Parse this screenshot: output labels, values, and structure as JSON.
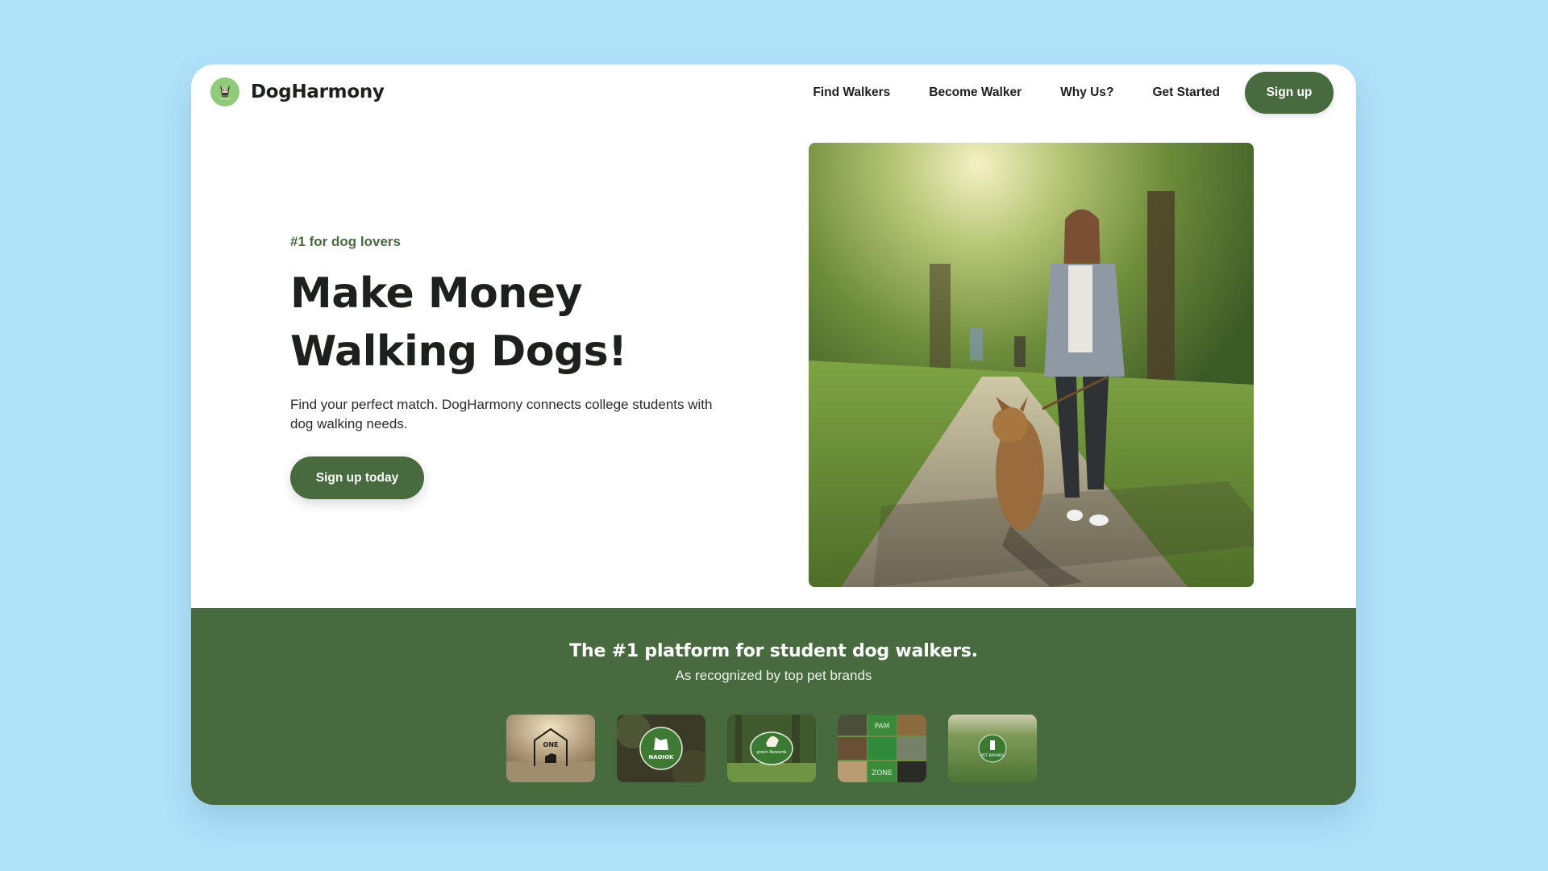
{
  "colors": {
    "background": "#b0e2fa",
    "brand_green": "#486a3f",
    "logo_bg": "#8fcb7a"
  },
  "header": {
    "logo_icon": "dog-logo-icon",
    "brand_name": "DogHarmony",
    "nav": [
      {
        "label": "Find Walkers"
      },
      {
        "label": "Become Walker"
      },
      {
        "label": "Why Us?"
      },
      {
        "label": "Get Started"
      }
    ],
    "signup_label": "Sign up"
  },
  "hero": {
    "eyebrow": "#1 for dog lovers",
    "title_line1": "Make Money",
    "title_line2": "Walking Dogs!",
    "description": "Find your perfect match. DogHarmony connects college students with dog walking needs.",
    "cta_label": "Sign up today",
    "image_alt": "Woman walking a dog on a sunny park path"
  },
  "recognition": {
    "title": "The #1 platform for student dog walkers.",
    "subtitle": "As recognized by top pet brands",
    "brands": [
      {
        "name": "brand-logo-one",
        "text": "ONE"
      },
      {
        "name": "brand-logo-naoiok",
        "text": "NAOIOK"
      },
      {
        "name": "brand-logo-green-dog",
        "text": "green Rewards"
      },
      {
        "name": "brand-logo-collage",
        "text": "PAM"
      },
      {
        "name": "brand-logo-pet-brands",
        "text": "PET BRANDS"
      }
    ]
  }
}
